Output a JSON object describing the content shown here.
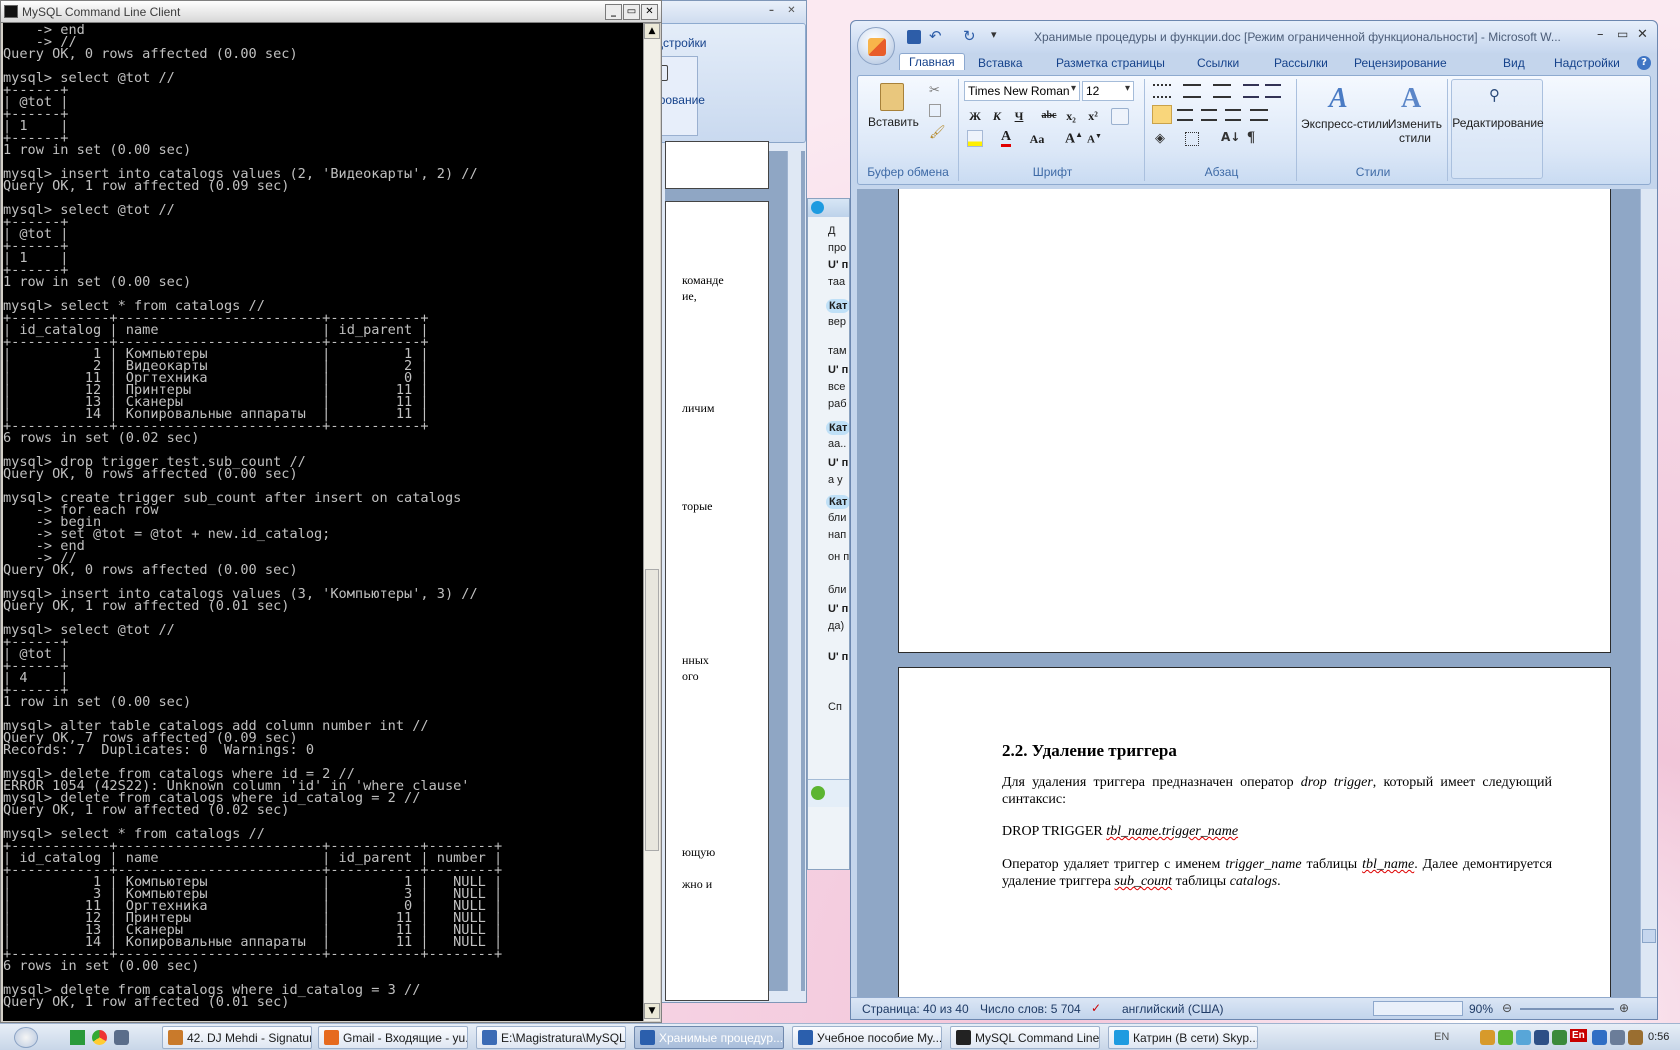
{
  "mysql_window": {
    "title": "MySQL Command Line Client",
    "console_lines": [
      "    -> end",
      "    -> //",
      "Query OK, 0 rows affected (0.00 sec)",
      "",
      "mysql> select @tot //",
      "+------+",
      "| @tot |",
      "+------+",
      "| 1    |",
      "+------+",
      "1 row in set (0.00 sec)",
      "",
      "mysql> insert into catalogs values (2, 'Видеокарты', 2) //",
      "Query OK, 1 row affected (0.09 sec)",
      "",
      "mysql> select @tot //",
      "+------+",
      "| @tot |",
      "+------+",
      "| 1    |",
      "+------+",
      "1 row in set (0.00 sec)",
      "",
      "mysql> select * from catalogs //",
      "+------------+-------------------------+-----------+",
      "| id_catalog | name                    | id_parent |",
      "+------------+-------------------------+-----------+",
      "|          1 | Компьютеры              |         1 |",
      "|          2 | Видеокарты              |         2 |",
      "|         11 | Оргтехника              |         0 |",
      "|         12 | Принтеры                |        11 |",
      "|         13 | Сканеры                 |        11 |",
      "|         14 | Копировальные аппараты  |        11 |",
      "+------------+-------------------------+-----------+",
      "6 rows in set (0.02 sec)",
      "",
      "mysql> drop trigger test.sub_count //",
      "Query OK, 0 rows affected (0.00 sec)",
      "",
      "mysql> create trigger sub_count after insert on catalogs",
      "    -> for each row",
      "    -> begin",
      "    -> set @tot = @tot + new.id_catalog;",
      "    -> end",
      "    -> //",
      "Query OK, 0 rows affected (0.00 sec)",
      "",
      "mysql> insert into catalogs values (3, 'Компьютеры', 3) //",
      "Query OK, 1 row affected (0.01 sec)",
      "",
      "mysql> select @tot //",
      "+------+",
      "| @tot |",
      "+------+",
      "| 4    |",
      "+------+",
      "1 row in set (0.00 sec)",
      "",
      "mysql> alter table catalogs add column number int //",
      "Query OK, 7 rows affected (0.09 sec)",
      "Records: 7  Duplicates: 0  Warnings: 0",
      "",
      "mysql> delete from catalogs where id = 2 //",
      "ERROR 1054 (42S22): Unknown column 'id' in 'where clause'",
      "mysql> delete from catalogs where id_catalog = 2 //",
      "Query OK, 1 row affected (0.02 sec)",
      "",
      "mysql> select * from catalogs //",
      "+------------+-------------------------+-----------+--------+",
      "| id_catalog | name                    | id_parent | number |",
      "+------------+-------------------------+-----------+--------+",
      "|          1 | Компьютеры              |         1 |   NULL |",
      "|          3 | Компьютеры              |         3 |   NULL |",
      "|         11 | Оргтехника              |         0 |   NULL |",
      "|         12 | Принтеры                |        11 |   NULL |",
      "|         13 | Сканеры                 |        11 |   NULL |",
      "|         14 | Копировальные аппараты  |        11 |   NULL |",
      "+------------+-------------------------+-----------+--------+",
      "6 rows in set (0.00 sec)",
      "",
      "mysql> delete from catalogs where id_catalog = 3 //",
      "Query OK, 1 row affected (0.01 sec)"
    ]
  },
  "bg_word": {
    "ribbon_tab_partial": "дстройки",
    "ribbon_btn_partial": "ирование",
    "fragments": [
      "команде",
      "ие,",
      "личим",
      "торые",
      "нных",
      "ого",
      "ющую",
      "жно и"
    ]
  },
  "skype": {
    "lines": [
      "Д",
      "про",
      "U' п",
      "таа",
      "Кат",
      "вер",
      "там",
      "U' п",
      "все",
      "раб",
      "Кат",
      "аа..",
      "U' п",
      "а у",
      "Кат",
      "бли",
      "нап",
      "он п",
      "бли",
      "U' п",
      "да)",
      "U' п",
      "Сп"
    ]
  },
  "word": {
    "title": "Хранимые процедуры и функции.doc [Режим ограниченной функциональности] - Microsoft W...",
    "tabs": [
      "Главная",
      "Вставка",
      "Разметка страницы",
      "Ссылки",
      "Рассылки",
      "Рецензирование",
      "Вид",
      "Надстройки"
    ],
    "groups": {
      "clipboard": "Буфер обмена",
      "font": "Шрифт",
      "paragraph": "Абзац",
      "styles": "Стили"
    },
    "paste_label": "Вставить",
    "font_name": "Times New Roman",
    "font_size": "12",
    "express_styles": "Экспресс-стили",
    "change_styles_1": "Изменить",
    "change_styles_2": "стили",
    "editing": "Редактирование",
    "font_buttons": {
      "bold": "Ж",
      "italic": "К",
      "underline": "Ч",
      "strike": "abc",
      "sub": "x₂",
      "sup": "x²",
      "case": "Aa"
    },
    "doc": {
      "heading": "2.2. Удаление триггера",
      "p1_a": "Для удаления триггера предназначен оператор ",
      "p1_i": "drop trigger",
      "p1_b": ", который имеет следующий синтаксис:",
      "syntax_a": "DROP TRIGGER ",
      "syntax_i": "tbl_name.trigger_name",
      "p2_a": "Оператор удаляет триггер с именем ",
      "p2_i1": "trigger_name",
      "p2_b": " таблицы ",
      "p2_i2": "tbl_name",
      "p2_c": ". Далее демонтируется удаление триггера ",
      "p2_i3": "sub_count",
      "p2_d": " таблицы ",
      "p2_i4": "catalogs",
      "p2_e": "."
    },
    "status": {
      "page": "Страница: 40 из 40",
      "words": "Число слов: 5 704",
      "lang": "английский (США)",
      "zoom": "90%"
    }
  },
  "taskbar": {
    "items": [
      {
        "label": "42. DJ Mehdi - Signatur...",
        "icon_color": "#c97a2b"
      },
      {
        "label": "Gmail - Входящие - yu...",
        "icon_color": "#e66a1e"
      },
      {
        "label": "E:\\Magistratura\\MySQL",
        "icon_color": "#3b6bb5"
      },
      {
        "label": "Хранимые процедур...",
        "icon_color": "#2b5fad"
      },
      {
        "label": "Учебное пособие My...",
        "icon_color": "#2b5fad"
      },
      {
        "label": "MySQL Command Line ...",
        "icon_color": "#222222"
      },
      {
        "label": "Катрин (В сети) Skyp...",
        "icon_color": "#1e9be0"
      }
    ],
    "lang": "EN",
    "tray_lang": "En",
    "clock": "0:56"
  }
}
